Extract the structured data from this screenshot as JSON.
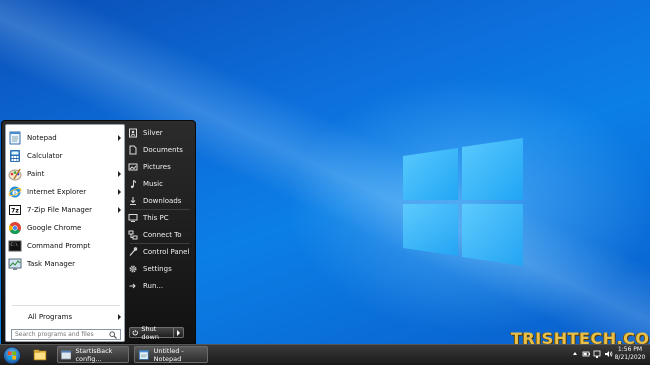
{
  "start_menu": {
    "programs": [
      {
        "label": "Notepad",
        "icon": "notepad-icon",
        "has_submenu": true
      },
      {
        "label": "Calculator",
        "icon": "calculator-icon",
        "has_submenu": false
      },
      {
        "label": "Paint",
        "icon": "paint-icon",
        "has_submenu": true
      },
      {
        "label": "Internet Explorer",
        "icon": "internet-explorer-icon",
        "has_submenu": true
      },
      {
        "label": "7-Zip File Manager",
        "icon": "7zip-icon",
        "has_submenu": true
      },
      {
        "label": "Google Chrome",
        "icon": "chrome-icon",
        "has_submenu": false
      },
      {
        "label": "Command Prompt",
        "icon": "command-prompt-icon",
        "has_submenu": false
      },
      {
        "label": "Task Manager",
        "icon": "task-manager-icon",
        "has_submenu": false
      }
    ],
    "all_programs_label": "All Programs",
    "search_placeholder": "Search programs and files",
    "right_items": [
      {
        "label": "Silver",
        "icon": "user-folder-icon"
      },
      {
        "label": "Documents",
        "icon": "documents-icon"
      },
      {
        "label": "Pictures",
        "icon": "pictures-icon"
      },
      {
        "label": "Music",
        "icon": "music-icon"
      },
      {
        "label": "Downloads",
        "icon": "downloads-icon"
      },
      {
        "label": "This PC",
        "icon": "computer-icon"
      },
      {
        "label": "Connect To",
        "icon": "network-icon"
      },
      {
        "label": "Control Panel",
        "icon": "control-panel-icon"
      },
      {
        "label": "Settings",
        "icon": "settings-gear-icon"
      },
      {
        "label": "Run...",
        "icon": "run-icon"
      }
    ],
    "shutdown_label": "Shut down"
  },
  "taskbar": {
    "tasks": [
      {
        "label": "StartIsBack config...",
        "icon": "startisback-icon"
      },
      {
        "label": "Untitled - Notepad",
        "icon": "notepad-icon"
      }
    ],
    "clock_time": "1:56 PM",
    "clock_date": "8/21/2020"
  },
  "watermark": "TRISHTECH.COM",
  "colors": {
    "desktop": "#0b6fdc",
    "menu_dark": "#1a1a1a",
    "watermark": "#e6c04a"
  }
}
